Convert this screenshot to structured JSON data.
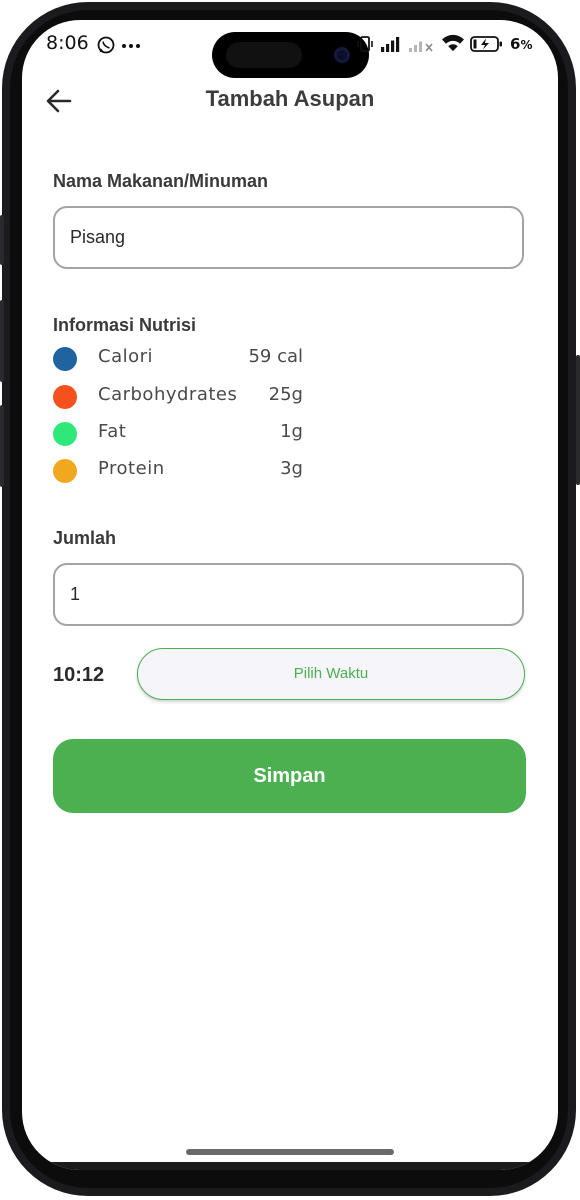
{
  "status_bar": {
    "time": "8:06",
    "left_icons": [
      "whatsapp-icon",
      "more-dots-icon"
    ],
    "right_icons": [
      "vibrate-icon",
      "signal-icon",
      "signal-no-service-icon",
      "wifi-icon",
      "battery-charging-icon"
    ],
    "battery_percent": "6"
  },
  "header": {
    "title": "Tambah Asupan",
    "back_icon": "arrow-left-icon"
  },
  "food_name": {
    "label": "Nama Makanan/Minuman",
    "value": "Pisang"
  },
  "nutrition": {
    "label": "Informasi Nutrisi",
    "items": [
      {
        "name": "Calori",
        "value": "59 cal",
        "color": "#1f64a0"
      },
      {
        "name": "Carbohydrates",
        "value": "25g",
        "color": "#f4511e"
      },
      {
        "name": "Fat",
        "value": "1g",
        "color": "#2ee87a"
      },
      {
        "name": "Protein",
        "value": "3g",
        "color": "#f0a81e"
      }
    ]
  },
  "quantity": {
    "label": "Jumlah",
    "value": "1"
  },
  "time_picker": {
    "time": "10:12",
    "button_label": "Pilih Waktu"
  },
  "save_button": {
    "label": "Simpan"
  },
  "colors": {
    "accent": "#4caf50",
    "title_text": "#3c3c3c",
    "input_border": "#a3a3a3"
  }
}
